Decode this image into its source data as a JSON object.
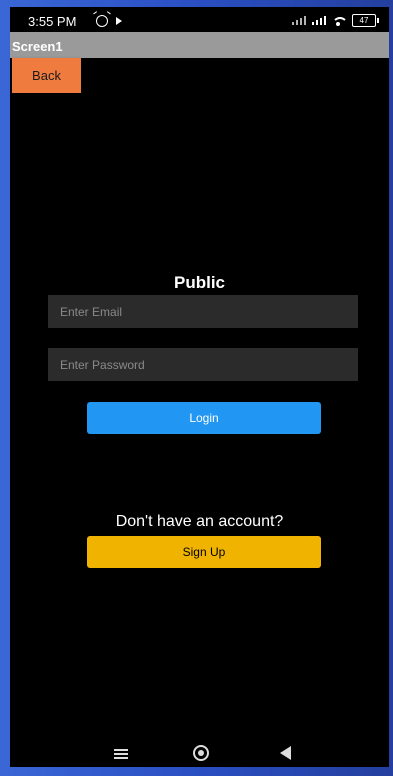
{
  "status_bar": {
    "time": "3:55 PM",
    "battery": "47",
    "icons": [
      "alarm-icon",
      "play-icon",
      "signal-icon",
      "signal-icon",
      "wifi-icon",
      "battery-icon"
    ]
  },
  "title_bar": {
    "title": "Screen1"
  },
  "back_button": {
    "label": "Back"
  },
  "form": {
    "heading": "Public",
    "email_placeholder": "Enter Email",
    "password_placeholder": "Enter Password",
    "login_label": "Login"
  },
  "signup": {
    "prompt": "Don't have an account?",
    "button_label": "Sign Up"
  },
  "nav_bar": {
    "icons": [
      "menu-icon",
      "home-icon",
      "back-icon"
    ]
  },
  "colors": {
    "frame": "#2f56c9",
    "back_button": "#ef7c3e",
    "login_button": "#2196f3",
    "signup_button": "#f0b400",
    "title_bar": "#9a9a9a",
    "input_bg": "#2b2b2b"
  }
}
